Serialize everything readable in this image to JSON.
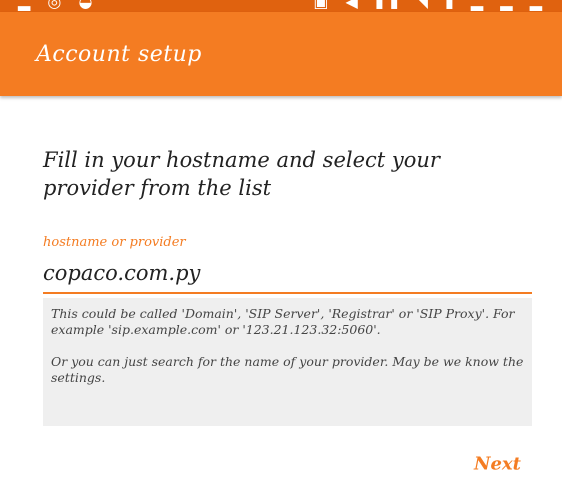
{
  "header": {
    "title": "Account setup"
  },
  "form": {
    "instruction": "Fill in your hostname and select your provider from the list",
    "hostname_label": "hostname or provider",
    "hostname_value": "copaco.com.py",
    "help_text_1": "This could be called 'Domain', 'SIP Server', 'Registrar' or 'SIP Proxy'. For example 'sip.example.com' or '123.21.123.32:5060'.",
    "help_text_2": "Or you can just search for the name of your provider. May be we know the settings."
  },
  "actions": {
    "next_label": "Next"
  },
  "colors": {
    "accent": "#f47c22",
    "status_bar": "#e0620f"
  }
}
